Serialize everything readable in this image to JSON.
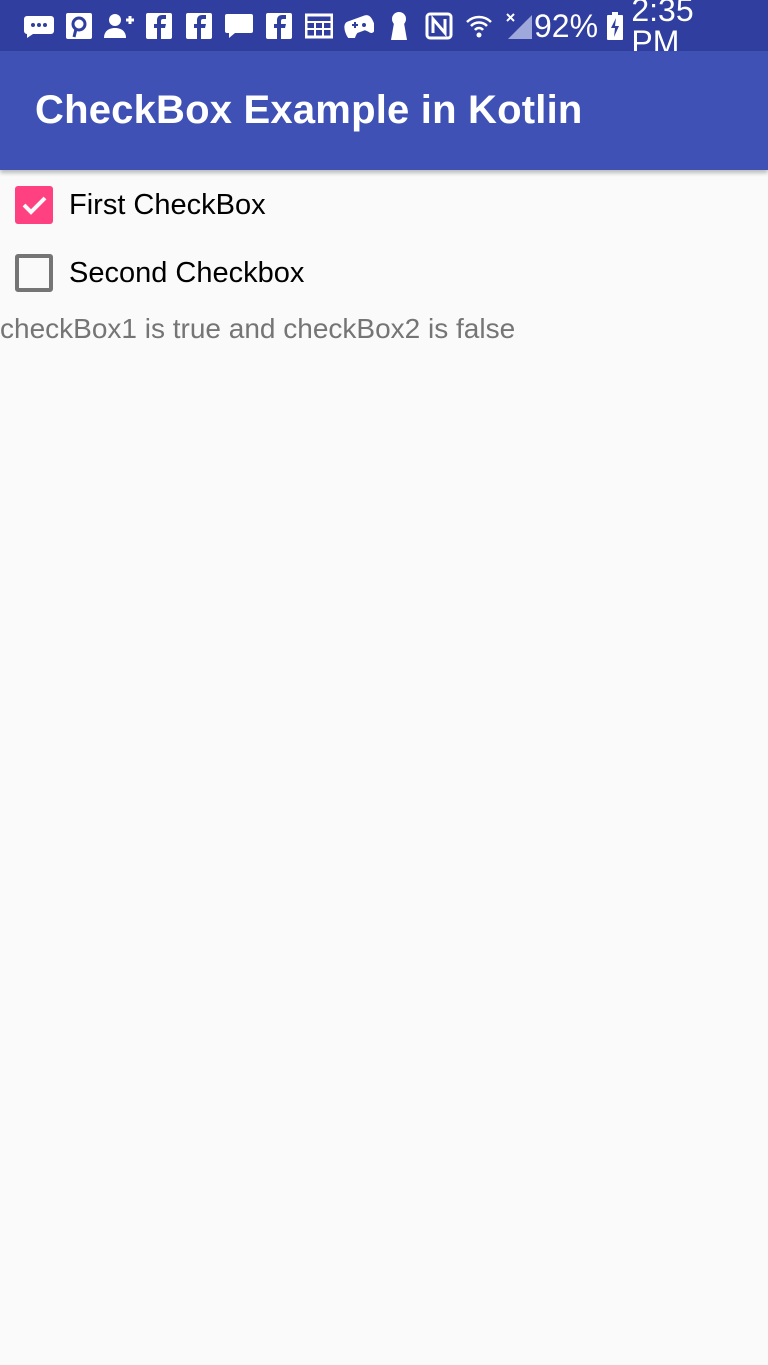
{
  "status_bar": {
    "battery": "92%",
    "time": "2:35 PM",
    "icons": [
      "sms-icon",
      "pinterest-icon",
      "add-contact-icon",
      "facebook-icon",
      "facebook-icon",
      "message-icon",
      "facebook-icon",
      "calendar-icon",
      "gamepad-icon",
      "keyhole-icon",
      "nfc-icon",
      "wifi-icon",
      "no-signal-icon",
      "battery-charging-icon"
    ],
    "color": "#303f9f"
  },
  "toolbar": {
    "title": "CheckBox Example in Kotlin",
    "color": "#3f51b5"
  },
  "checkboxes": [
    {
      "label": "First CheckBox",
      "checked": true
    },
    {
      "label": "Second Checkbox",
      "checked": false
    }
  ],
  "result_text": "checkBox1 is true and checkBox2 is false",
  "accent_color": "#ff4081"
}
